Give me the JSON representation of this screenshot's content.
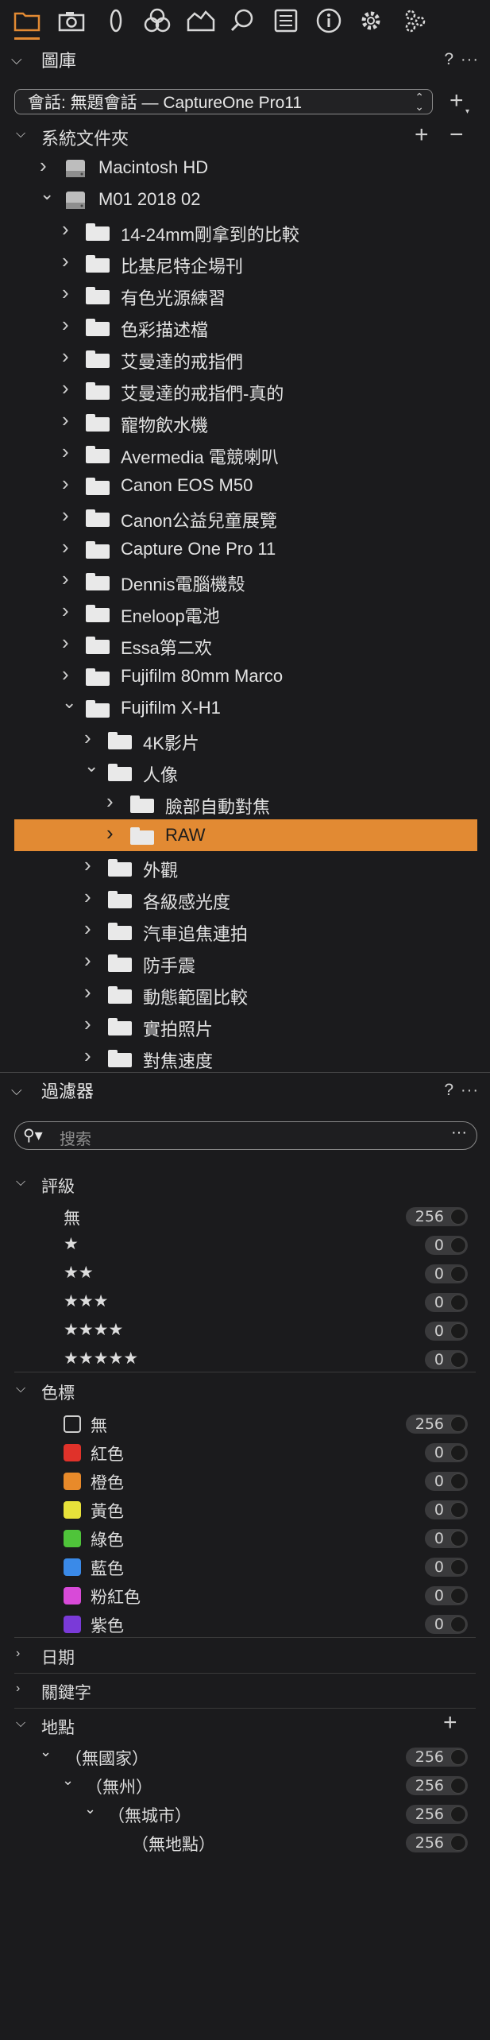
{
  "toolbar": {
    "icons": [
      "folder-icon",
      "camera-icon",
      "lens-icon",
      "color-icon",
      "exposure-icon",
      "search-icon",
      "metadata-icon",
      "info-icon",
      "gear-icon",
      "plugins-icon"
    ]
  },
  "library": {
    "title": "圖庫",
    "help": "?",
    "more": "···",
    "session_label": "會話: 無題會話 — CaptureOne Pro11",
    "add": "+"
  },
  "system_folders": {
    "title": "系統文件夾",
    "add": "+",
    "remove": "−"
  },
  "tree": [
    {
      "label": "Macintosh HD",
      "type": "drive",
      "level": 1,
      "expanded": false
    },
    {
      "label": "M01 2018 02",
      "type": "drive",
      "level": 1,
      "expanded": true
    },
    {
      "label": "14-24mm剛拿到的比較",
      "type": "folder",
      "level": 2,
      "expanded": false
    },
    {
      "label": "比基尼特企場刊",
      "type": "folder",
      "level": 2,
      "expanded": false
    },
    {
      "label": "有色光源練習",
      "type": "folder",
      "level": 2,
      "expanded": false
    },
    {
      "label": "色彩描述檔",
      "type": "folder",
      "level": 2,
      "expanded": false
    },
    {
      "label": "艾曼達的戒指們",
      "type": "folder",
      "level": 2,
      "expanded": false
    },
    {
      "label": "艾曼達的戒指們-真的",
      "type": "folder",
      "level": 2,
      "expanded": false
    },
    {
      "label": "寵物飲水機",
      "type": "folder",
      "level": 2,
      "expanded": false
    },
    {
      "label": "Avermedia 電競喇叭",
      "type": "folder",
      "level": 2,
      "expanded": false
    },
    {
      "label": "Canon EOS M50",
      "type": "folder",
      "level": 2,
      "expanded": false
    },
    {
      "label": "Canon公益兒童展覽",
      "type": "folder",
      "level": 2,
      "expanded": false
    },
    {
      "label": "Capture One Pro 11",
      "type": "folder",
      "level": 2,
      "expanded": false
    },
    {
      "label": "Dennis電腦機殼",
      "type": "folder",
      "level": 2,
      "expanded": false
    },
    {
      "label": "Eneloop電池",
      "type": "folder",
      "level": 2,
      "expanded": false
    },
    {
      "label": "Essa第二欢",
      "type": "folder",
      "level": 2,
      "expanded": false
    },
    {
      "label": "Fujifilm 80mm Marco",
      "type": "folder",
      "level": 2,
      "expanded": false
    },
    {
      "label": "Fujifilm X-H1",
      "type": "folder",
      "level": 2,
      "expanded": true
    },
    {
      "label": "4K影片",
      "type": "folder",
      "level": 3,
      "expanded": false
    },
    {
      "label": "人像",
      "type": "folder",
      "level": 3,
      "expanded": true
    },
    {
      "label": "臉部自動對焦",
      "type": "folder",
      "level": 4,
      "expanded": false
    },
    {
      "label": "RAW",
      "type": "folder",
      "level": 4,
      "expanded": false,
      "selected": true
    },
    {
      "label": "外觀",
      "type": "folder",
      "level": 3,
      "expanded": false
    },
    {
      "label": "各級感光度",
      "type": "folder",
      "level": 3,
      "expanded": false
    },
    {
      "label": "汽車追焦連拍",
      "type": "folder",
      "level": 3,
      "expanded": false
    },
    {
      "label": "防手震",
      "type": "folder",
      "level": 3,
      "expanded": false
    },
    {
      "label": "動態範圍比較",
      "type": "folder",
      "level": 3,
      "expanded": false
    },
    {
      "label": "實拍照片",
      "type": "folder",
      "level": 3,
      "expanded": false
    },
    {
      "label": "對焦速度",
      "type": "folder",
      "level": 3,
      "expanded": false
    }
  ],
  "filters": {
    "title": "過濾器",
    "help": "?",
    "more": "···",
    "search_placeholder": "搜索",
    "search_more": "···",
    "rating": {
      "title": "評級",
      "rows": [
        {
          "label": "無",
          "count": "256"
        },
        {
          "label": "★",
          "count": "0"
        },
        {
          "label": "★★",
          "count": "0"
        },
        {
          "label": "★★★",
          "count": "0"
        },
        {
          "label": "★★★★",
          "count": "0"
        },
        {
          "label": "★★★★★",
          "count": "0"
        }
      ]
    },
    "color_tag": {
      "title": "色標",
      "rows": [
        {
          "label": "無",
          "count": "256",
          "color": "none"
        },
        {
          "label": "紅色",
          "count": "0",
          "color": "#e0322a"
        },
        {
          "label": "橙色",
          "count": "0",
          "color": "#e88a2a"
        },
        {
          "label": "黃色",
          "count": "0",
          "color": "#e8e23a"
        },
        {
          "label": "綠色",
          "count": "0",
          "color": "#4fc43a"
        },
        {
          "label": "藍色",
          "count": "0",
          "color": "#3a8ae8"
        },
        {
          "label": "粉紅色",
          "count": "0",
          "color": "#d84ad8"
        },
        {
          "label": "紫色",
          "count": "0",
          "color": "#7a3ad8"
        }
      ]
    },
    "date": {
      "title": "日期"
    },
    "keywords": {
      "title": "關鍵字"
    },
    "location": {
      "title": "地點",
      "add": "+",
      "rows": [
        {
          "label": "（無國家）",
          "count": "256",
          "level": 1
        },
        {
          "label": "（無州）",
          "count": "256",
          "level": 2
        },
        {
          "label": "（無城市）",
          "count": "256",
          "level": 3
        },
        {
          "label": "（無地點）",
          "count": "256",
          "level": 4
        }
      ]
    }
  },
  "colors": {
    "accent": "#e28a33",
    "background": "#1b1b1d"
  }
}
